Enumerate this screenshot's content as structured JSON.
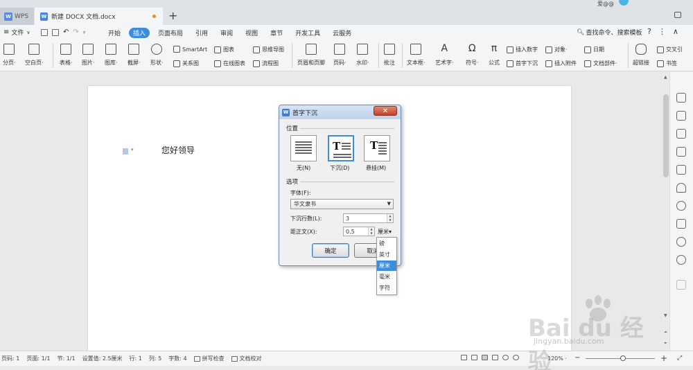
{
  "titlebar": {
    "wps_tab_label": "WPS",
    "doc_tab_label": "新建 DOCX 文档.docx",
    "user_name": "爱@@"
  },
  "menu": {
    "file_label": "文件",
    "tabs": [
      "开始",
      "插入",
      "页面布局",
      "引用",
      "审阅",
      "视图",
      "章节",
      "开发工具",
      "云服务"
    ],
    "active_tab": "插入",
    "search_label": "查找命令、搜索模板"
  },
  "ribbon": {
    "page_break": "分页·",
    "blank_page": "空白页·",
    "table": "表格·",
    "picture": "图片·",
    "gallery": "图库·",
    "screenshot": "截屏·",
    "shapes": "形状·",
    "smartart": "SmartArt",
    "chart": "图表",
    "relation_chart": "关系图",
    "online_chart": "在线图表",
    "mind_map": "思维导图",
    "flowchart": "流程图",
    "header_footer": "页眉和页脚",
    "page_number": "页码·",
    "watermark": "水印·",
    "comment": "批注",
    "textbox": "文本框·",
    "wordart": "艺术字·",
    "symbol": "符号·",
    "formula": "公式",
    "insert_number": "插入数字",
    "object": "对象·",
    "drop_cap": "首字下沉",
    "attachment": "插入附件",
    "date": "日期",
    "doc_parts": "文档部件·",
    "hyperlink": "超链接",
    "cross_ref": "交叉引",
    "bookmark": "书签"
  },
  "document": {
    "text": "您好领导"
  },
  "dialog": {
    "title": "首字下沉",
    "close": "✕",
    "position_group": "位置",
    "pos_none": "无(N)",
    "pos_drop": "下沉(D)",
    "pos_margin": "悬挂(M)",
    "selected_position": "下沉(D)",
    "options_group": "选项",
    "font_label": "字体(F):",
    "font_value": "华文隶书",
    "lines_label": "下沉行数(L):",
    "lines_value": "3",
    "distance_label": "距正文(X):",
    "distance_value": "0.5",
    "unit_value": "厘米▾",
    "ok": "确定",
    "cancel": "取消"
  },
  "unit_dropdown": {
    "options": [
      "磅",
      "英寸",
      "厘米",
      "毫米",
      "字符"
    ],
    "selected": "厘米"
  },
  "status": {
    "page_code": "页码: 1",
    "page": "页面: 1/1",
    "section": "节: 1/1",
    "setting": "设置值: 2.5厘米",
    "row": "行: 1",
    "col": "列: 5",
    "words": "字数: 4",
    "spell_check": "拼写检查",
    "doc_proof": "文档校对",
    "zoom": "120% ·"
  },
  "watermark": {
    "brand": "Bai du 经验",
    "url": "jingyan.baidu.com"
  },
  "colors": {
    "accent": "#3c8cdc",
    "close_button": "#c0412a",
    "modified_dot": "#f08a24"
  }
}
